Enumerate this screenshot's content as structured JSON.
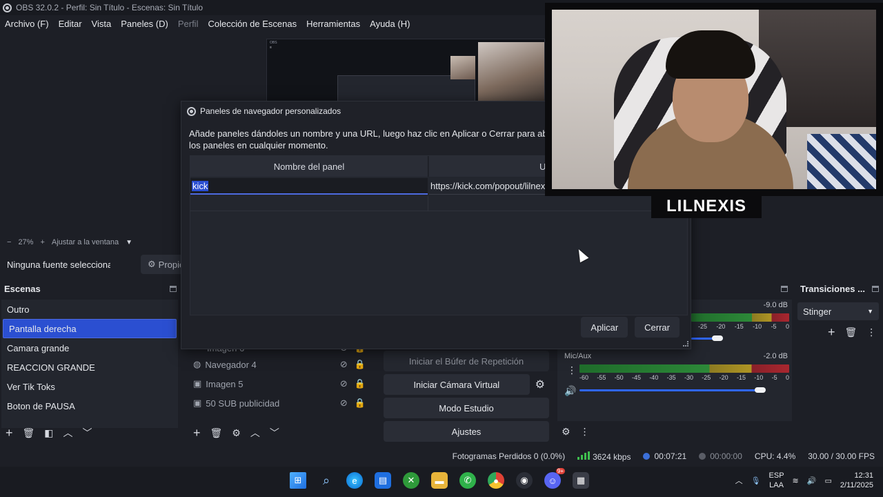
{
  "window": {
    "title": "OBS 32.0.2 - Perfil: Sin Título - Escenas: Sin Título"
  },
  "menu": [
    "Archivo (F)",
    "Editar",
    "Vista",
    "Paneles (D)",
    "Perfil",
    "Colección de Escenas",
    "Herramientas",
    "Ayuda (H)"
  ],
  "preview": {
    "zoom": "27%",
    "fit_label": "Ajustar a la ventana"
  },
  "source_bar": {
    "no_source": "Ninguna fuente seleccionada",
    "properties_label": "Propiedades"
  },
  "scenes": {
    "title": "Escenas",
    "items": [
      "Outro",
      "Pantalla derecha",
      "Camara grande",
      "REACCION GRANDE",
      "Ver Tik Toks",
      "Boton de PAUSA"
    ],
    "selected": "Pantalla derecha"
  },
  "sources": {
    "items": [
      "Imagen 6",
      "Navegador 4",
      "Imagen 5",
      "50 SUB publicidad"
    ]
  },
  "controls": {
    "replay_buffer": "Iniciar el Búfer de Repetición",
    "virtual_cam": "Iniciar Cámara Virtual",
    "studio_mode": "Modo Estudio",
    "settings": "Ajustes"
  },
  "mixer": {
    "channel1": {
      "db": "-9.0 dB",
      "volume": 0.55
    },
    "channel2": {
      "name": "Mic/Aux",
      "db": "-2.0 dB",
      "volume": 0.87
    },
    "scale": [
      "-60",
      "-55",
      "-50",
      "-45",
      "-40",
      "-35",
      "-30",
      "-25",
      "-20",
      "-15",
      "-10",
      "-5",
      "0"
    ],
    "scale_short": [
      "-25",
      "-20",
      "-15",
      "-10",
      "-5",
      "0"
    ]
  },
  "transitions": {
    "title": "Transiciones ...",
    "selected": "Stinger"
  },
  "status": {
    "dropped_frames": "Fotogramas Perdidos 0 (0.0%)",
    "bitrate": "3624 kbps",
    "live_time": "00:07:21",
    "rec_time": "00:00:00",
    "cpu": "CPU: 4.4%",
    "fps": "30.00 / 30.00 FPS"
  },
  "dialog": {
    "title": "Paneles de navegador personalizados",
    "description_line1": "Añade paneles dándoles un nombre y una URL, luego haz clic en Aplicar o Cerrar para abrir los",
    "description_line2": "los paneles en cualquier momento.",
    "col_name": "Nombre del panel",
    "col_url": "U",
    "row_name": "kick",
    "row_url": "https://kick.com/popout/lilnexis/chat",
    "apply_label": "Aplicar",
    "close_label": "Cerrar"
  },
  "webcam": {
    "name_tag": "LILNEXIS"
  },
  "taskbar": {
    "lang_top": "ESP",
    "lang_bottom": "LAA",
    "time": "12:31",
    "date": "2/11/2025",
    "discord_badge": "9+"
  },
  "colors": {
    "accent": "#2b4fd1",
    "background": "#1d1f26",
    "panel": "#23262e"
  }
}
